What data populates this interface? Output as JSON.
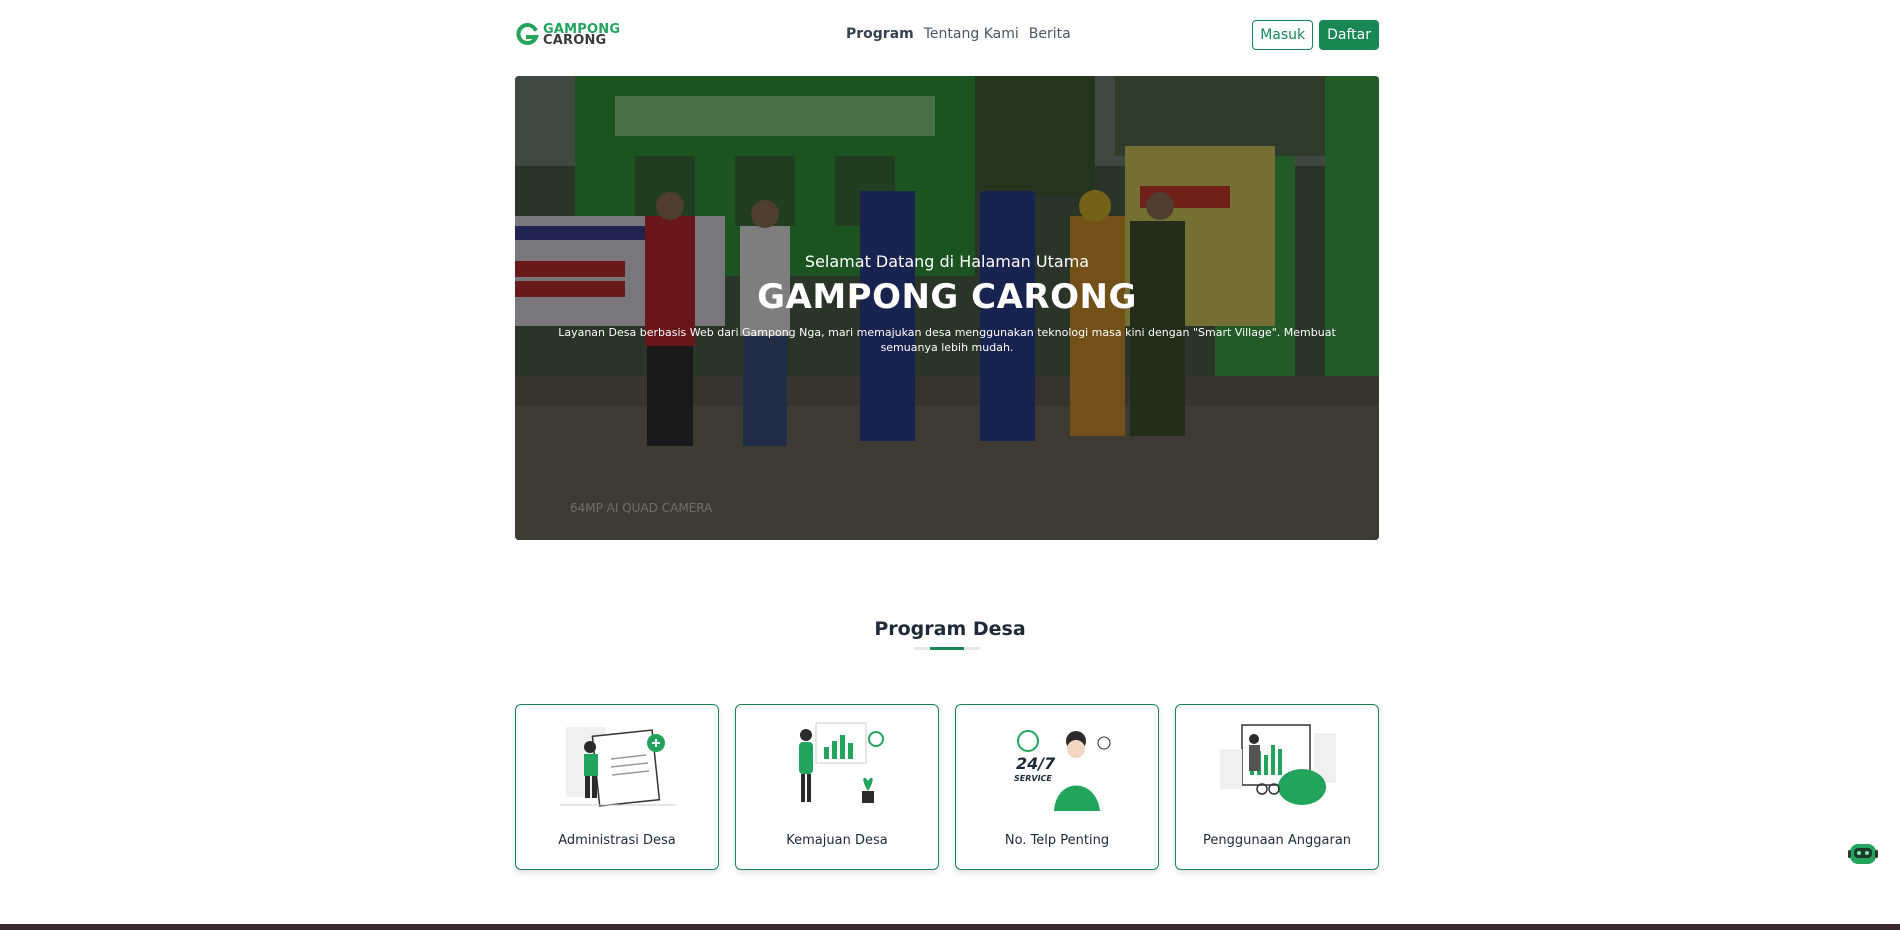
{
  "brand": {
    "line1": "GAMPONG",
    "line2": "CARONG",
    "green": "#22a45d",
    "dark": "#3a3a3a"
  },
  "nav": {
    "items": [
      {
        "label": "Program"
      },
      {
        "label": "Tentang Kami"
      },
      {
        "label": "Berita"
      }
    ]
  },
  "auth": {
    "login": "Masuk",
    "register": "Daftar"
  },
  "hero": {
    "subtitle": "Selamat Datang di Halaman Utama",
    "title": "GAMPONG CARONG",
    "description": "Layanan Desa berbasis Web dari Gampong Nga, mari memajukan desa menggunakan teknologi masa kini dengan \"Smart Village\". Membuat semuanya lebih mudah."
  },
  "section": {
    "title": "Program Desa"
  },
  "programs": [
    {
      "label": "Administrasi Desa",
      "icon": "document-illustration"
    },
    {
      "label": "Kemajuan Desa",
      "icon": "growth-chart-illustration"
    },
    {
      "label": "No. Telp Penting",
      "icon": "247-service-illustration"
    },
    {
      "label": "Penggunaan Anggaran",
      "icon": "budget-piggybank-illustration"
    }
  ],
  "colors": {
    "accent": "#198754",
    "footer": "#3a2a2c"
  }
}
